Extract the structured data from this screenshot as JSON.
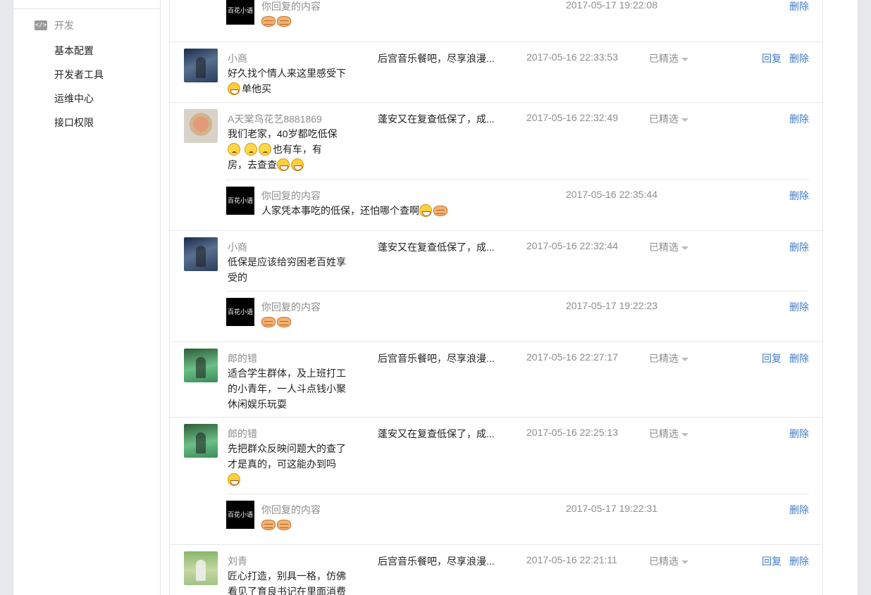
{
  "sidebar": {
    "section_label": "开发",
    "section_icon": "code-icon",
    "items": [
      {
        "label": "基本配置"
      },
      {
        "label": "开发者工具"
      },
      {
        "label": "运维中心"
      },
      {
        "label": "接口权限"
      }
    ]
  },
  "comments": [
    {
      "reply": {
        "author_avatar_text": "百花小语",
        "author": "你回复的内容",
        "time": "2017-05-17 19:22:08",
        "delete_label": "删除"
      }
    },
    {
      "nickname": "小商",
      "message": "好久找个情人来这里感受下",
      "message_tail": "单他买",
      "article": "后宫音乐餐吧，尽享浪漫...",
      "time": "2017-05-16 22:33:53",
      "featured_label": "已精选",
      "reply_label": "回复",
      "delete_label": "删除"
    },
    {
      "nickname": "A天棠鸟花艺8881869",
      "message_line1": "我们老家，40岁都吃低保",
      "message_line2": "也有车，有",
      "message_line3": "房，去查查",
      "article": "蓬安又在复查低保了，成...",
      "time": "2017-05-16 22:32:49",
      "featured_label": "已精选",
      "delete_label": "删除",
      "reply": {
        "author_avatar_text": "百花小语",
        "author": "你回复的内容",
        "text": "人家凭本事吃的低保，还怕哪个查啊",
        "time": "2017-05-16 22:35:44",
        "delete_label": "删除"
      }
    },
    {
      "nickname": "小商",
      "message_line1": "低保是应该给穷困老百姓享",
      "message_line2": "受的",
      "article": "蓬安又在复查低保了，成...",
      "time": "2017-05-16 22:32:44",
      "featured_label": "已精选",
      "delete_label": "删除",
      "reply": {
        "author_avatar_text": "百花小语",
        "author": "你回复的内容",
        "time": "2017-05-17 19:22:23",
        "delete_label": "删除"
      }
    },
    {
      "nickname": "郎的错",
      "message_line1": "适合学生群体，及上班打工",
      "message_line2": "的小青年，一人斗点钱小聚",
      "message_line3": "休闲娱乐玩耍",
      "article": "后宫音乐餐吧，尽享浪漫...",
      "time": "2017-05-16 22:27:17",
      "featured_label": "已精选",
      "reply_label": "回复",
      "delete_label": "删除"
    },
    {
      "nickname": "郎的错",
      "message_line1": "先把群众反映问题大的查了",
      "message_line2": "才是真的，可这能办到吗",
      "article": "蓬安又在复查低保了，成...",
      "time": "2017-05-16 22:25:13",
      "featured_label": "已精选",
      "delete_label": "删除",
      "reply": {
        "author_avatar_text": "百花小语",
        "author": "你回复的内容",
        "time": "2017-05-17 19:22:31",
        "delete_label": "删除"
      }
    },
    {
      "nickname": "刘青",
      "message_line1": "匠心打造，别具一格，仿佛",
      "message_line2": "看见了育良书记在里面消费",
      "article": "后宫音乐餐吧，尽享浪漫...",
      "time": "2017-05-16 22:21:11",
      "featured_label": "已精选",
      "reply_label": "回复",
      "delete_label": "删除"
    }
  ]
}
